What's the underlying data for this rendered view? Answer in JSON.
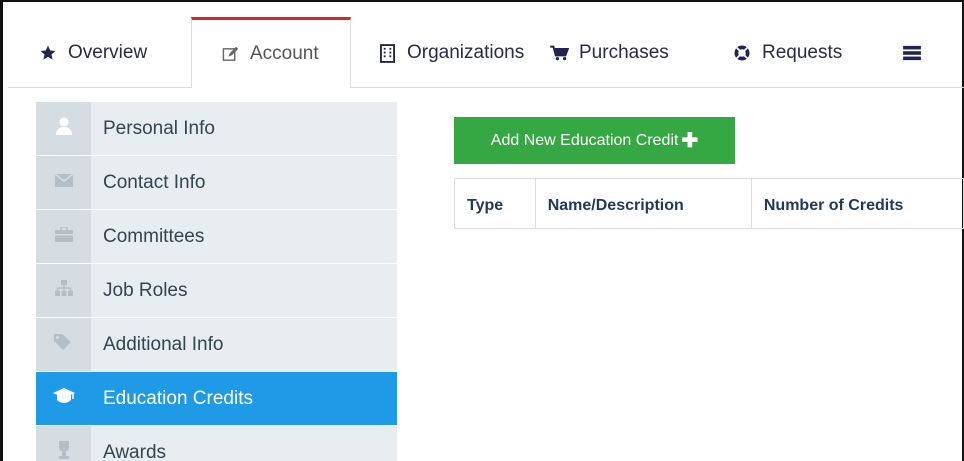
{
  "tabs": [
    {
      "label": "Overview",
      "icon": "star-icon"
    },
    {
      "label": "Account",
      "icon": "edit-icon"
    },
    {
      "label": "Organizations",
      "icon": "building-icon"
    },
    {
      "label": "Purchases",
      "icon": "cart-icon"
    },
    {
      "label": "Requests",
      "icon": "lifebuoy-icon"
    },
    {
      "label": "",
      "icon": "list-icon"
    }
  ],
  "sidebar": {
    "items": [
      {
        "label": "Personal Info",
        "icon": "user-icon"
      },
      {
        "label": "Contact Info",
        "icon": "envelope-icon"
      },
      {
        "label": "Committees",
        "icon": "briefcase-icon"
      },
      {
        "label": "Job Roles",
        "icon": "sitemap-icon"
      },
      {
        "label": "Additional Info",
        "icon": "tags-icon"
      },
      {
        "label": "Education Credits",
        "icon": "graduation-cap-icon",
        "active": true
      },
      {
        "label": "Awards",
        "icon": "trophy-icon"
      }
    ]
  },
  "main": {
    "add_button_label": "Add New Education Credit",
    "table_headers": [
      "Type",
      "Name/Description",
      "Number of Credits"
    ]
  },
  "colors": {
    "active_tab_accent": "#d9291c",
    "active_sidebar": "#1f9ae6",
    "add_button": "#35a843"
  }
}
